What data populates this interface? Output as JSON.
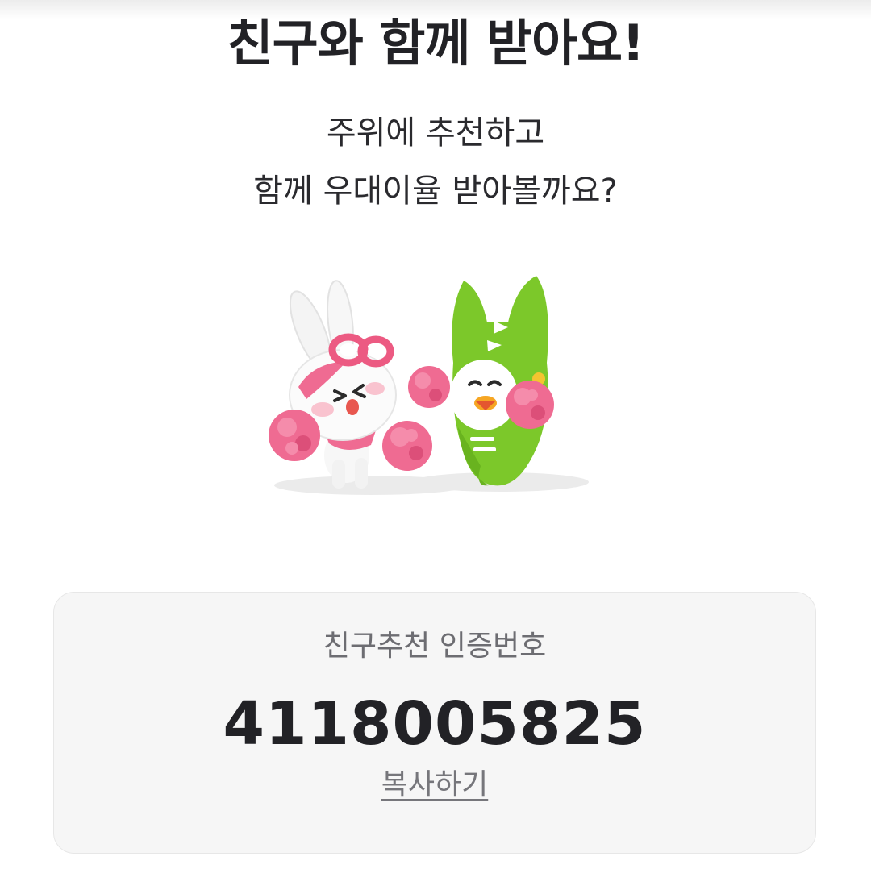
{
  "header": {
    "title": "친구와 함께 받아요!"
  },
  "intro": {
    "line1": "주위에 추천하고",
    "line2": "함께 우대이율 받아볼까요?"
  },
  "referral": {
    "label": "친구추천 인증번호",
    "code": "4118005825",
    "copy_label": "복사하기"
  },
  "colors": {
    "text_primary": "#222226",
    "text_secondary": "#6d6d72",
    "card_background": "#f6f6f6",
    "mascot_green": "#7cc82a",
    "pompom_pink": "#ef6b92"
  },
  "icons": {
    "illustration": "cheering-mascots-illustration"
  }
}
